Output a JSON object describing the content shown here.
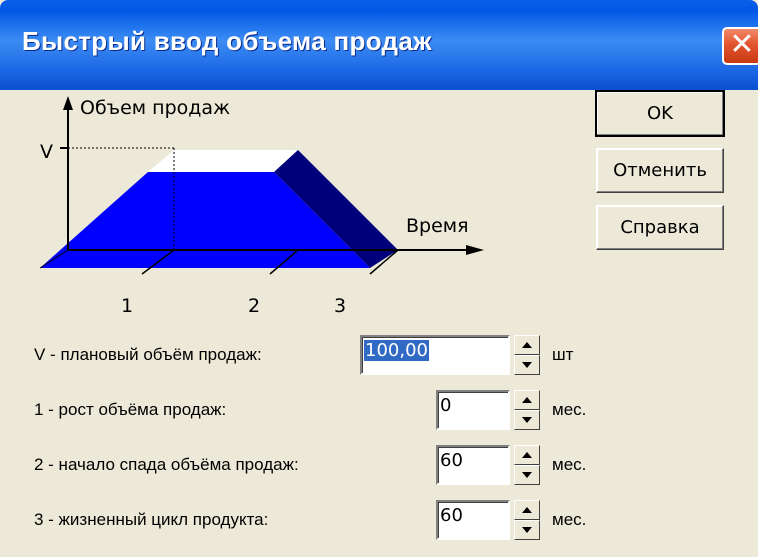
{
  "window": {
    "title": "Быстрый ввод объема продаж",
    "close_glyph": "✕"
  },
  "diagram": {
    "y_axis_label": "Объем продаж",
    "x_axis_label": "Время",
    "v_label": "V",
    "markers": [
      "1",
      "2",
      "3"
    ],
    "fill_color": "#0000ff",
    "shade_color": "#00007a"
  },
  "buttons": {
    "ok": "OK",
    "cancel": "Отменить",
    "help": "Справка"
  },
  "fields": [
    {
      "label": "V - плановый объём продаж:",
      "value": "100,00",
      "unit": "шт"
    },
    {
      "label": "1 - рост объёма продаж:",
      "value": "0",
      "unit": "мес."
    },
    {
      "label": "2 - начало спада объёма продаж:",
      "value": "60",
      "unit": "мес."
    },
    {
      "label": "3 - жизненный цикл продукта:",
      "value": "60",
      "unit": "мес."
    }
  ]
}
